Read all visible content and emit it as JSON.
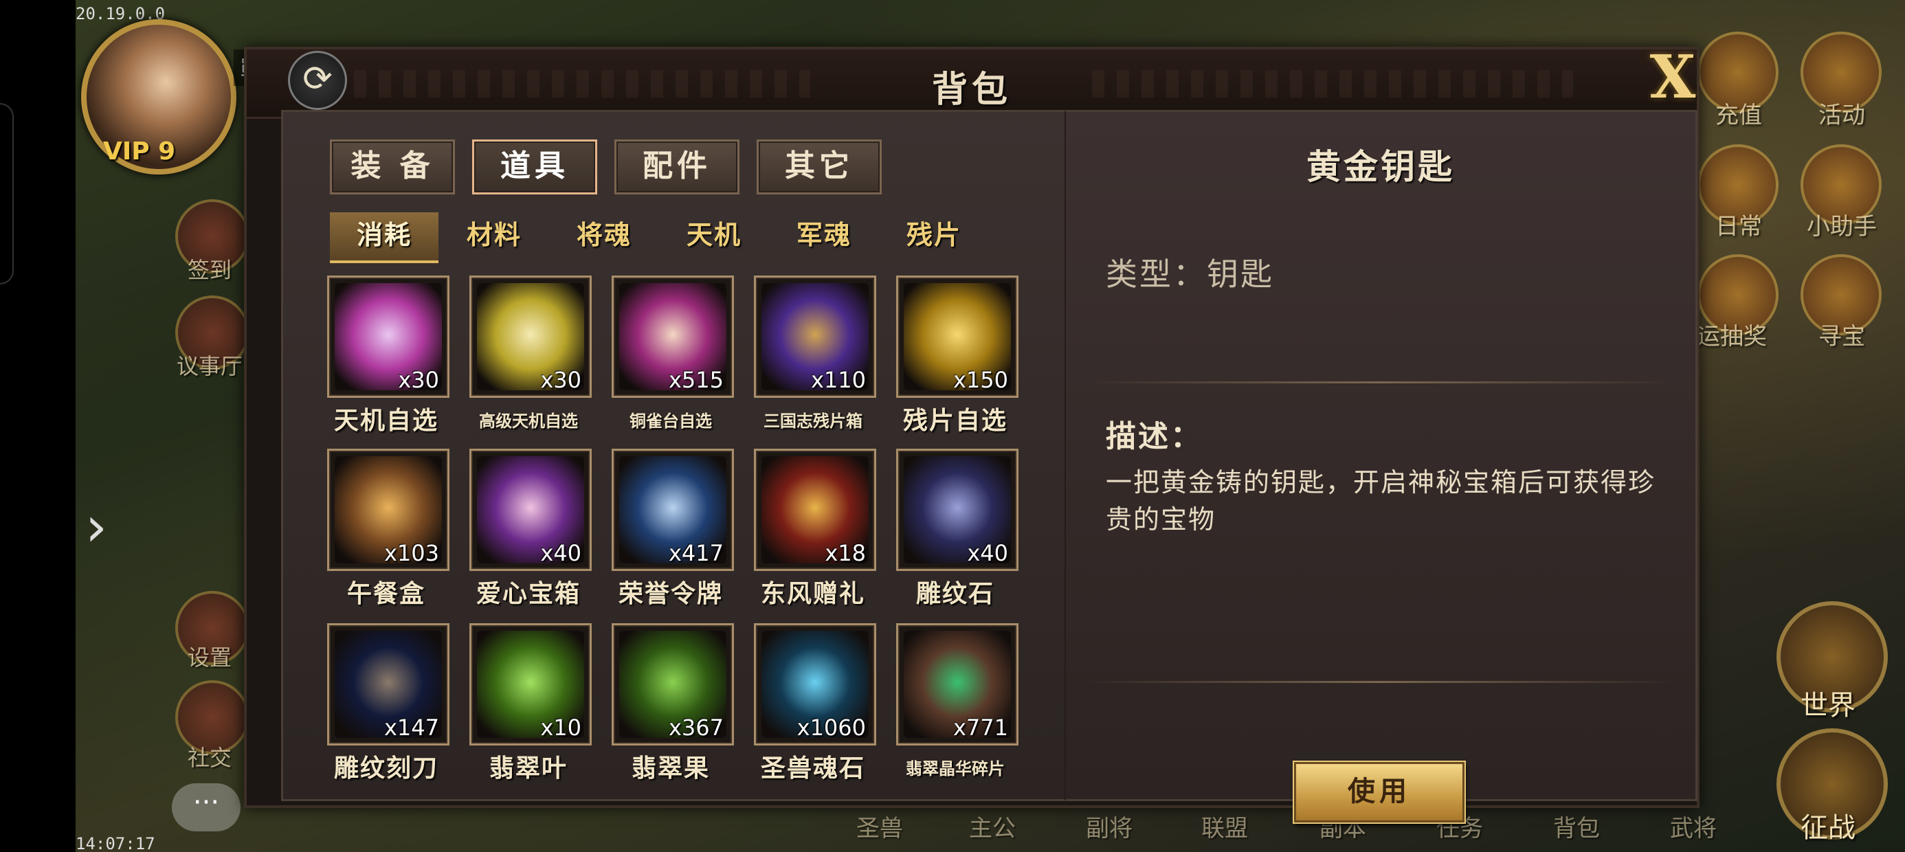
{
  "status": {
    "top_left": "20.19.0.0",
    "bottom_time": "14:07:17"
  },
  "hud": {
    "vip": "VIP 9",
    "battle_label": "戰力",
    "left_menu": [
      "签到",
      "议事厅",
      "设置",
      "社交"
    ],
    "right_menu": [
      "充值",
      "活动",
      "日常",
      "小助手",
      "运抽奖",
      "寻宝"
    ],
    "world": "世界",
    "expedition": "征战",
    "bottom_nav": [
      "圣兽",
      "主公",
      "副将",
      "联盟",
      "副本",
      "任务",
      "背包",
      "武将"
    ]
  },
  "window": {
    "title": "背包",
    "refresh_icon": "refresh-icon",
    "close_icon": "close-icon",
    "close_glyph": "X"
  },
  "tabs": [
    "装 备",
    "道具",
    "配件",
    "其它"
  ],
  "active_tab": 1,
  "subtabs": [
    "消耗",
    "材料",
    "将魂",
    "天机",
    "军魂",
    "残片"
  ],
  "active_subtab": 0,
  "items": [
    {
      "name": "天机自选",
      "count": "x30",
      "color": "#b0399f",
      "accent": "#e9c6f0",
      "small": false
    },
    {
      "name": "高级天机自选",
      "count": "x30",
      "color": "#b8a52a",
      "accent": "#f4e9b2",
      "small": true
    },
    {
      "name": "铜雀台自选",
      "count": "x515",
      "color": "#9a2a7a",
      "accent": "#f3d6c2",
      "small": true
    },
    {
      "name": "三国志残片箱",
      "count": "x110",
      "color": "#4a2a8a",
      "accent": "#cfa352",
      "small": true
    },
    {
      "name": "残片自选",
      "count": "x150",
      "color": "#a27a12",
      "accent": "#f6d870",
      "small": false
    },
    {
      "name": "午餐盒",
      "count": "x103",
      "color": "#7a4a22",
      "accent": "#e8b25a",
      "small": false
    },
    {
      "name": "爱心宝箱",
      "count": "x40",
      "color": "#6a2a8a",
      "accent": "#f0c2e0",
      "small": false
    },
    {
      "name": "荣誉令牌",
      "count": "x417",
      "color": "#1f3f72",
      "accent": "#b8d2f0",
      "small": false
    },
    {
      "name": "东风赠礼",
      "count": "x18",
      "color": "#7a1e16",
      "accent": "#e8b44a",
      "small": false
    },
    {
      "name": "雕纹石",
      "count": "x40",
      "color": "#2a2a5a",
      "accent": "#9aa0d8",
      "small": false
    },
    {
      "name": "雕纹刻刀",
      "count": "x147",
      "color": "#121a3a",
      "accent": "#8a7a6a",
      "small": false
    },
    {
      "name": "翡翠叶",
      "count": "x10",
      "color": "#3a6a12",
      "accent": "#9fe060",
      "small": false
    },
    {
      "name": "翡翠果",
      "count": "x367",
      "color": "#2f5a12",
      "accent": "#8ad050",
      "small": false
    },
    {
      "name": "圣兽魂石",
      "count": "x1060",
      "color": "#123a52",
      "accent": "#6ad0f0",
      "small": false
    },
    {
      "name": "翡翠晶华碎片",
      "count": "x771",
      "color": "#5a3a2a",
      "accent": "#3ac070",
      "small": true
    }
  ],
  "detail": {
    "title": "黄金钥匙",
    "type_line": "类型：钥匙",
    "desc_heading": "描述：",
    "desc": "一把黄金铸的钥匙，开启神秘宝箱后可获得珍贵的宝物",
    "use_button": "使用"
  }
}
